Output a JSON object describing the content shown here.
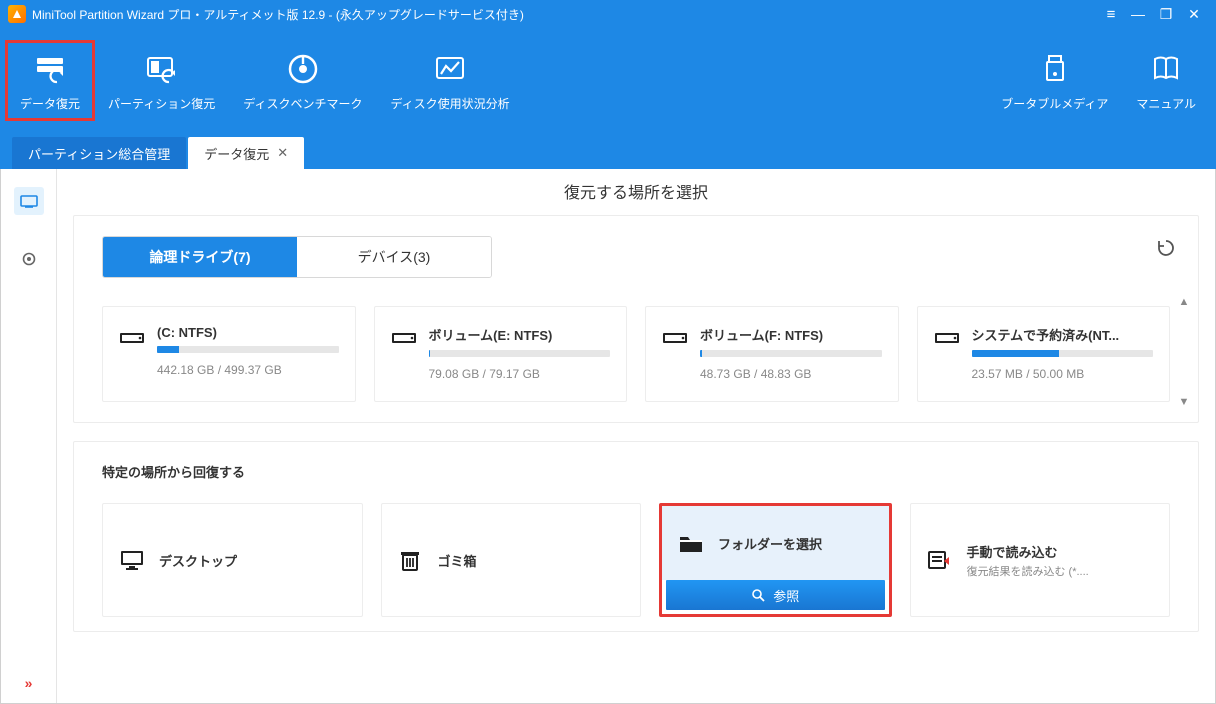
{
  "titlebar": {
    "title": "MiniTool Partition Wizard プロ・アルティメット版 12.9 - (永久アップグレードサービス付き)"
  },
  "toolbar": {
    "items": [
      {
        "label": "データ復元",
        "icon": "recovery"
      },
      {
        "label": "パーティション復元",
        "icon": "partition-recovery"
      },
      {
        "label": "ディスクベンチマーク",
        "icon": "benchmark"
      },
      {
        "label": "ディスク使用状況分析",
        "icon": "analyzer"
      }
    ],
    "right": [
      {
        "label": "ブータブルメディア",
        "icon": "bootable"
      },
      {
        "label": "マニュアル",
        "icon": "manual"
      }
    ]
  },
  "tabs": [
    {
      "label": "パーティション総合管理",
      "active": false,
      "closable": false
    },
    {
      "label": "データ復元",
      "active": true,
      "closable": true
    }
  ],
  "main": {
    "title": "復元する場所を選択",
    "drive_tabs": {
      "logical": "論理ドライブ(7)",
      "device": "デバイス(3)"
    },
    "drives": [
      {
        "name": "(C: NTFS)",
        "size": "442.18 GB / 499.37 GB",
        "pct": 12
      },
      {
        "name": "ボリューム(E: NTFS)",
        "size": "79.08 GB / 79.17 GB",
        "pct": 1
      },
      {
        "name": "ボリューム(F: NTFS)",
        "size": "48.73 GB / 48.83 GB",
        "pct": 1
      },
      {
        "name": "システムで予約済み(NT...",
        "size": "23.57 MB / 50.00 MB",
        "pct": 48
      }
    ],
    "section_heading": "特定の場所から回復する",
    "locations": {
      "desktop": "デスクトップ",
      "trash": "ゴミ箱",
      "folder": "フォルダーを選択",
      "browse": "参照",
      "manual_title": "手動で読み込む",
      "manual_sub": "復元結果を読み込む (*...."
    }
  }
}
